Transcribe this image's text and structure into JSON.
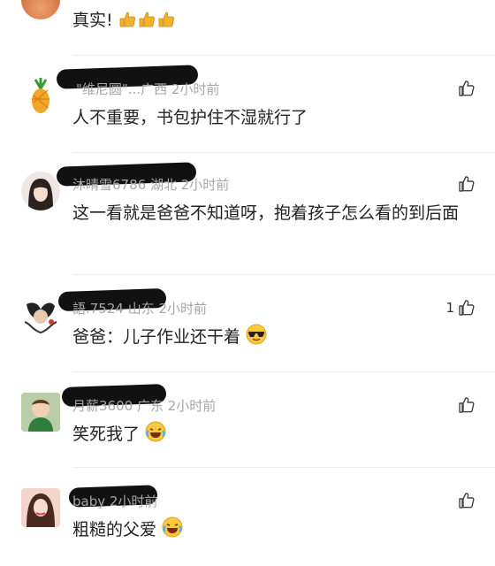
{
  "comments": [
    {
      "meta": "",
      "text": "真实!",
      "likes": ""
    },
    {
      "meta": "\"维尼圆\"...广西 2小时前",
      "text": "人不重要，书包护住不湿就行了",
      "likes": ""
    },
    {
      "meta": "沐晴雪6786 湖北 2小时前",
      "text": "这一看就是爸爸不知道呀，抱着孩子怎么看的到后面",
      "likes": ""
    },
    {
      "meta": "語.7524 山东 2小时前",
      "text": "爸爸：儿子作业还干着",
      "likes": "1"
    },
    {
      "meta": "月薪3600 广东 2小时前",
      "text": "笑死我了",
      "likes": ""
    },
    {
      "meta": "baby 2小时前",
      "text": "粗糙的父爱",
      "likes": ""
    }
  ],
  "icons": {
    "like": "thumbs-up-icon",
    "emoji_thumbs": "thumbs-up-emoji-icon",
    "emoji_sunglasses": "sunglasses-emoji-icon",
    "emoji_laugh_cry": "laughing-crying-emoji-icon"
  }
}
